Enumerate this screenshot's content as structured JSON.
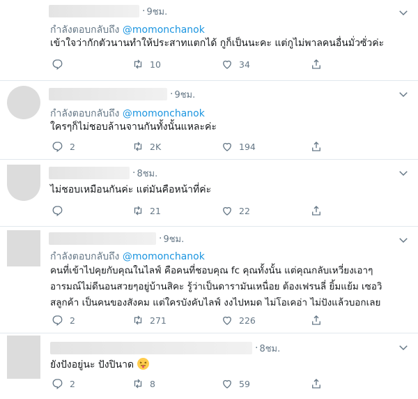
{
  "tweets": [
    {
      "time": "9ชม.",
      "reply_prefix": "กำลังตอบกลับถึง",
      "reply_mention": "@momonchanok",
      "lines": [
        "เข้าใจว่ากักตัวนานทำให้ประสาทแตกได้ กูก็เป็นนะคะ  แต่กูไม่พาลคนอื่นมั่วซั่วค่ะ"
      ],
      "replies": "",
      "retweets": "10",
      "likes": "34"
    },
    {
      "time": "9ชม.",
      "reply_prefix": "กำลังตอบกลับถึง",
      "reply_mention": "@momonchanok",
      "lines": [
        "ใครๆก็ไม่ชอบล้านจานกันทั้งนั้นแหละค่ะ"
      ],
      "replies": "2",
      "retweets": "2K",
      "likes": "194"
    },
    {
      "time": "8ชม.",
      "reply_prefix": "",
      "reply_mention": "",
      "lines": [
        "ไม่ชอบเหมือนกันค่ะ แต่มันคือหน้าที่ค่ะ"
      ],
      "replies": "",
      "retweets": "21",
      "likes": "22"
    },
    {
      "time": "9ชม.",
      "reply_prefix": "กำลังตอบกลับถึง",
      "reply_mention": "@momonchanok",
      "lines": [
        "คนที่เข้าไปคุยกับคุณในไลฟ์ คือคนที่ชอบคุณ fc คุณทั้งนั้น แต่คุณกลับเหวี่ยงเอาๆ",
        "อารมณ์ไม่ดีนอนสวยๆอยู่บ้านสิคะ รู้ว่าเป็นดารามันเหนื่อย ต้องเฟรนลี่ ยิ้มแย้ม เซอวิ",
        "สลูกค้า เป็นคนของสังคม แต่ใครบังคับไลฟ์ งงไปหมด ไม่โอเคอ่า ไม่ปังแล้วบอกเลย"
      ],
      "replies": "2",
      "retweets": "271",
      "likes": "226"
    },
    {
      "time": "8ชม.",
      "reply_prefix": "",
      "reply_mention": "",
      "lines": [
        "ยังปังอยู่นะ ปังปินาด"
      ],
      "emoji": "face-with-tongue-emoji",
      "replies": "2",
      "retweets": "8",
      "likes": "59"
    }
  ],
  "colors": {
    "secondary_text": "#657786",
    "mention": "#1b95e0",
    "divider": "#e1e8ed",
    "emoji": "#ffcc4d"
  }
}
